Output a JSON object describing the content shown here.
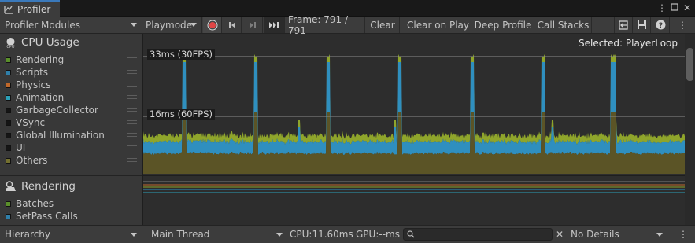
{
  "window": {
    "tab_title": "Profiler",
    "menu_icon": "kebab-menu-icon",
    "maximize_icon": "maximize-icon",
    "close_icon": "close-icon"
  },
  "toolbar": {
    "modules_dropdown": "Profiler Modules",
    "playmode_dropdown": "Playmode",
    "frame_label": "Frame: 791 / 791",
    "clear": "Clear",
    "clear_on_play": "Clear on Play",
    "deep_profile": "Deep Profile",
    "call_stacks": "Call Stacks"
  },
  "cpu_module": {
    "title": "CPU Usage",
    "series": [
      {
        "label": "Rendering",
        "color": "#5a8f2a"
      },
      {
        "label": "Scripts",
        "color": "#2f7fa9"
      },
      {
        "label": "Physics",
        "color": "#c0682a"
      },
      {
        "label": "Animation",
        "color": "#2ba0b7"
      },
      {
        "label": "GarbageCollector",
        "color": "#151515"
      },
      {
        "label": "VSync",
        "color": "#151515"
      },
      {
        "label": "Global Illumination",
        "color": "#151515"
      },
      {
        "label": "UI",
        "color": "#151515"
      },
      {
        "label": "Others",
        "color": "#74702f"
      }
    ],
    "ref_30fps": "33ms (30FPS)",
    "ref_60fps": "16ms (60FPS)",
    "selected": "Selected: PlayerLoop"
  },
  "rendering_module": {
    "title": "Rendering",
    "series": [
      {
        "label": "Batches",
        "color": "#5a8f2a"
      },
      {
        "label": "SetPass Calls",
        "color": "#2f7fa9"
      }
    ]
  },
  "bottom": {
    "view_dropdown": "Hierarchy",
    "thread_dropdown": "Main Thread",
    "cpu_time": "CPU:11.60ms",
    "gpu_time": "GPU:--ms",
    "search_value": "",
    "details_dropdown": "No Details"
  },
  "colors": {
    "rendering": "#8fa52b",
    "scripts": "#2f8fbf",
    "others": "#5b5426",
    "record": "#e04545"
  }
}
